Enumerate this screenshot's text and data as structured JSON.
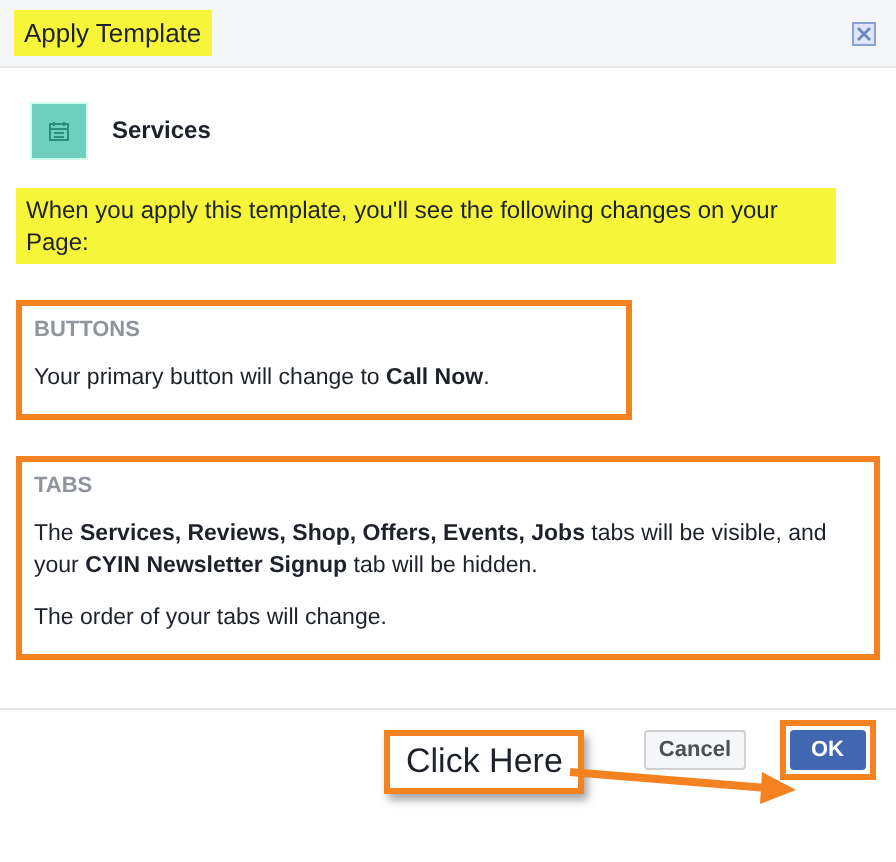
{
  "dialog": {
    "title": {
      "text": "Apply Template",
      "highlighted": true
    },
    "template": {
      "name": "Services"
    },
    "notice": {
      "text": "When you apply this template, you'll see the following changes on your Page:",
      "highlighted": true
    },
    "sections": [
      {
        "heading": "BUTTONS",
        "outlined": true,
        "paragraphs": [
          "Your primary button will change to **Call Now**."
        ]
      },
      {
        "heading": "TABS",
        "outlined": true,
        "paragraphs": [
          "The **Services, Reviews, Shop, Offers, Events, Jobs** tabs will be visible, and your **CYIN Newsletter Signup** tab will be hidden.",
          "The order of your tabs will change."
        ]
      }
    ],
    "buttons": [
      {
        "label": "Cancel",
        "kind": "secondary",
        "outlined": false
      },
      {
        "label": "OK",
        "kind": "primary",
        "outlined": true
      }
    ]
  },
  "annotation": {
    "callout": "Click Here"
  }
}
